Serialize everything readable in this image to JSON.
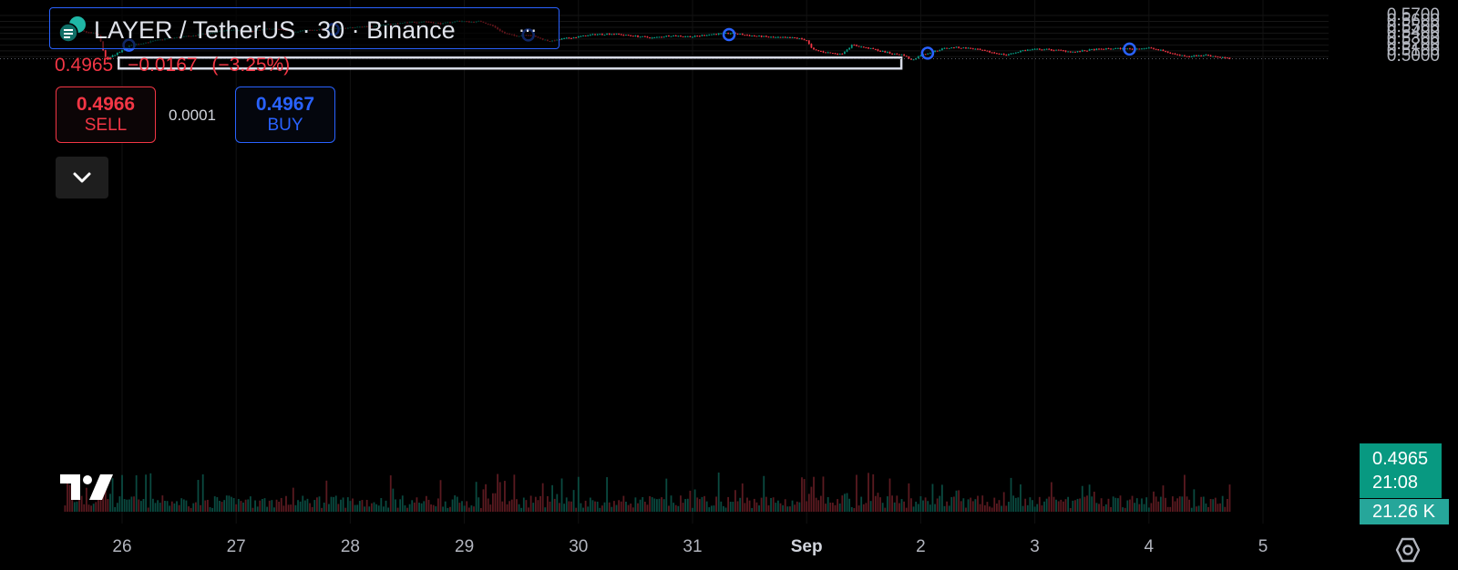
{
  "symbol": {
    "title": "LAYER / TetherUS · 30 · Binance",
    "more_icon": "⋯"
  },
  "quote": {
    "last": "0.4965",
    "change": "−0.0167",
    "change_pct": "(−3.25%)"
  },
  "trade": {
    "sell_price": "0.4966",
    "sell_label": "SELL",
    "spread": "0.0001",
    "buy_price": "0.4967",
    "buy_label": "BUY"
  },
  "price_tag": {
    "price": "0.4965",
    "countdown": "21:08",
    "volume": "21.26 K"
  },
  "colors": {
    "up": "#089981",
    "down": "#f23645",
    "accent": "#2962ff",
    "grid": "#1a1a1a"
  },
  "chart_data": {
    "type": "candlestick",
    "interval": "30",
    "y_ticks": [
      "0.5700",
      "0.5600",
      "0.5500",
      "0.5400",
      "0.5300",
      "0.5200",
      "0.5100",
      "0.5000"
    ],
    "ylim": [
      0.486,
      0.5715
    ],
    "x_ticks": [
      {
        "label": "26",
        "bold": false
      },
      {
        "label": "27",
        "bold": false
      },
      {
        "label": "28",
        "bold": false
      },
      {
        "label": "29",
        "bold": false
      },
      {
        "label": "30",
        "bold": false
      },
      {
        "label": "31",
        "bold": false
      },
      {
        "label": "Sep",
        "bold": true
      },
      {
        "label": "2",
        "bold": false
      },
      {
        "label": "3",
        "bold": false
      },
      {
        "label": "4",
        "bold": false
      },
      {
        "label": "5",
        "bold": false
      }
    ],
    "price_path": [
      [
        25.5,
        0.552
      ],
      [
        25.55,
        0.544
      ],
      [
        25.6,
        0.548
      ],
      [
        25.65,
        0.543
      ],
      [
        25.7,
        0.541
      ],
      [
        25.75,
        0.54
      ],
      [
        25.8,
        0.536
      ],
      [
        25.84,
        0.505
      ],
      [
        25.87,
        0.493
      ],
      [
        25.9,
        0.5
      ],
      [
        26.0,
        0.51
      ],
      [
        26.05,
        0.518
      ],
      [
        26.2,
        0.524
      ],
      [
        26.4,
        0.531
      ],
      [
        26.6,
        0.535
      ],
      [
        26.8,
        0.541
      ],
      [
        26.95,
        0.546
      ],
      [
        27.1,
        0.542
      ],
      [
        27.3,
        0.548
      ],
      [
        27.5,
        0.543
      ],
      [
        27.7,
        0.546
      ],
      [
        27.85,
        0.547
      ],
      [
        28.0,
        0.549
      ],
      [
        28.15,
        0.552
      ],
      [
        28.35,
        0.555
      ],
      [
        28.5,
        0.558
      ],
      [
        28.65,
        0.56
      ],
      [
        28.8,
        0.556
      ],
      [
        28.95,
        0.561
      ],
      [
        29.05,
        0.559
      ],
      [
        29.15,
        0.56
      ],
      [
        29.25,
        0.552
      ],
      [
        29.35,
        0.54
      ],
      [
        29.45,
        0.535
      ],
      [
        29.55,
        0.538
      ],
      [
        29.65,
        0.532
      ],
      [
        29.75,
        0.526
      ],
      [
        29.85,
        0.53
      ],
      [
        30.0,
        0.534
      ],
      [
        30.15,
        0.538
      ],
      [
        30.3,
        0.539
      ],
      [
        30.5,
        0.535
      ],
      [
        30.65,
        0.532
      ],
      [
        30.8,
        0.536
      ],
      [
        31.0,
        0.534
      ],
      [
        31.15,
        0.538
      ],
      [
        31.35,
        0.54
      ],
      [
        31.5,
        0.536
      ],
      [
        31.7,
        0.533
      ],
      [
        31.9,
        0.532
      ],
      [
        32.0,
        0.528
      ],
      [
        32.05,
        0.512
      ],
      [
        32.15,
        0.508
      ],
      [
        32.3,
        0.504
      ],
      [
        32.4,
        0.52
      ],
      [
        32.5,
        0.516
      ],
      [
        32.6,
        0.512
      ],
      [
        32.75,
        0.505
      ],
      [
        32.85,
        0.503
      ],
      [
        32.92,
        0.494
      ],
      [
        33.0,
        0.503
      ],
      [
        33.1,
        0.508
      ],
      [
        33.2,
        0.514
      ],
      [
        33.3,
        0.516
      ],
      [
        33.45,
        0.514
      ],
      [
        33.6,
        0.508
      ],
      [
        33.75,
        0.503
      ],
      [
        33.9,
        0.511
      ],
      [
        34.05,
        0.513
      ],
      [
        34.2,
        0.511
      ],
      [
        34.35,
        0.508
      ],
      [
        34.5,
        0.512
      ],
      [
        34.7,
        0.514
      ],
      [
        34.85,
        0.513
      ],
      [
        35.0,
        0.515
      ],
      [
        35.1,
        0.511
      ],
      [
        35.25,
        0.503
      ],
      [
        35.35,
        0.501
      ],
      [
        35.5,
        0.503
      ],
      [
        35.6,
        0.5
      ],
      [
        35.72,
        0.4965
      ]
    ],
    "markers": [
      [
        26.06,
        0.5195
      ],
      [
        27.85,
        0.5465
      ],
      [
        29.56,
        0.537
      ],
      [
        31.32,
        0.5375
      ],
      [
        33.06,
        0.506
      ],
      [
        34.83,
        0.513
      ]
    ],
    "support_zone": {
      "x_from": 25.97,
      "x_to": 32.83,
      "y_top": 0.4985,
      "y_bottom": 0.4972
    },
    "last_price_line": 0.4965
  }
}
